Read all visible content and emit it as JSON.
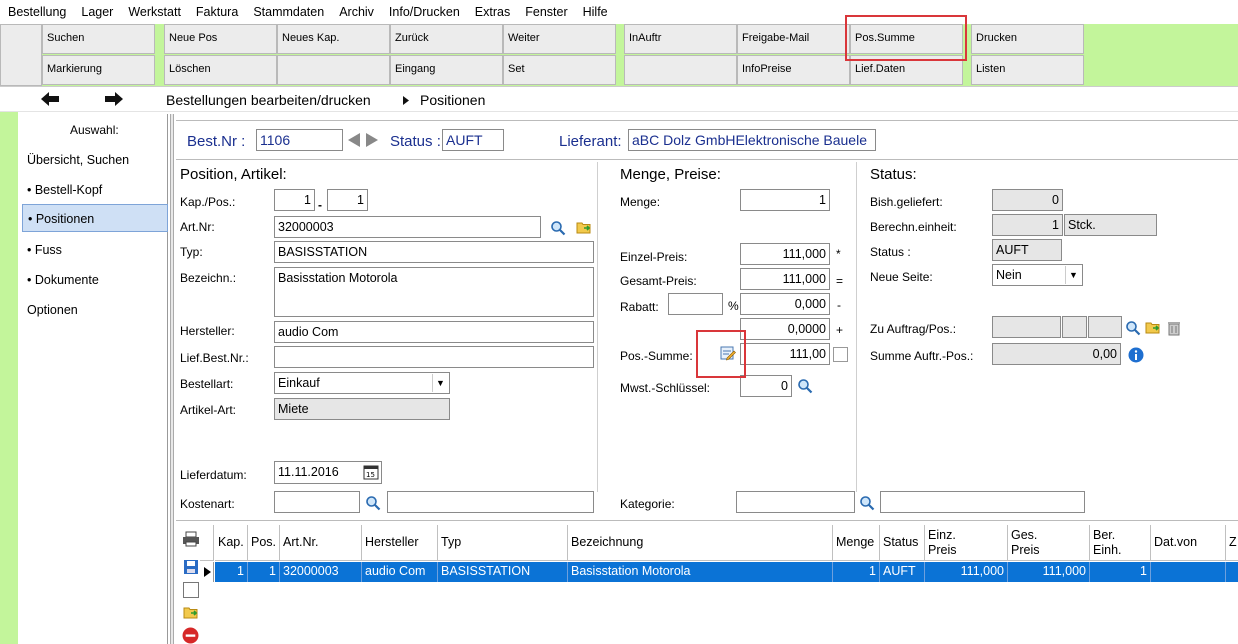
{
  "menu": [
    "Bestellung",
    "Lager",
    "Werkstatt",
    "Faktura",
    "Stammdaten",
    "Archiv",
    "Info/Drucken",
    "Extras",
    "Fenster",
    "Hilfe"
  ],
  "toolbar": {
    "suchen": "Suchen",
    "markierung": "Markierung",
    "neue_pos": "Neue Pos",
    "loeschen": "Löschen",
    "neues_kap": "Neues Kap.",
    "zurueck": "Zurück",
    "eingang": "Eingang",
    "weiter": "Weiter",
    "set": "Set",
    "inauftr": "InAuftr",
    "freigabe_mail": "Freigabe-Mail",
    "infopreise": "InfoPreise",
    "pos_summe": "Pos.Summe",
    "lief_daten": "Lief.Daten",
    "drucken": "Drucken",
    "listen": "Listen"
  },
  "breadcrumb": {
    "part1": "Bestellungen bearbeiten/drucken",
    "part2": "Positionen"
  },
  "sidebar": {
    "heading": "Auswahl:",
    "items": [
      "Übersicht, Suchen",
      "• Bestell-Kopf",
      "• Positionen",
      "• Fuss",
      "• Dokumente",
      "Optionen"
    ]
  },
  "header": {
    "best_nr_label": "Best.Nr :",
    "best_nr": "1106",
    "status_label": "Status :",
    "status": "AUFT",
    "lieferant_label": "Lieferant:",
    "lieferant": "aBC Dolz GmbHElektronische Bauele"
  },
  "position": {
    "title": "Position, Artikel:",
    "kap_label": "Kap./Pos.:",
    "kap": "1",
    "pos": "1",
    "sep": "-",
    "artnr_label": "Art.Nr:",
    "artnr": "32000003",
    "typ_label": "Typ:",
    "typ": "BASISSTATION",
    "bez_label": "Bezeichn.:",
    "bez": "Basisstation Motorola",
    "hersteller_label": "Hersteller:",
    "hersteller": "audio Com",
    "lief_label": "Lief.Best.Nr.:",
    "lief": "",
    "bestellart_label": "Bestellart:",
    "bestellart": "Einkauf",
    "artikelart_label": "Artikel-Art:",
    "artikelart": "Miete",
    "lieferdatum_label": "Lieferdatum:",
    "lieferdatum": "11.11.2016",
    "kostenart_label": "Kostenart:"
  },
  "preise": {
    "title": "Menge, Preise:",
    "menge_label": "Menge:",
    "menge": "1",
    "einzel_label": "Einzel-Preis:",
    "einzel": "111,000",
    "einzel_op": "*",
    "gesamt_label": "Gesamt-Preis:",
    "gesamt": "111,000",
    "gesamt_op": "=",
    "rabatt_label": "Rabatt:",
    "rabatt_pct": "",
    "pct_sign": "%",
    "rabatt": "0,000",
    "rabatt_op": "-",
    "extra": "0,0000",
    "extra_op": "+",
    "possumme_label": "Pos.-Summe:",
    "possumme": "111,00",
    "mwst_label": "Mwst.-Schlüssel:",
    "mwst": "0",
    "kategorie_label": "Kategorie:"
  },
  "status": {
    "title": "Status:",
    "geliefert_label": "Bish.geliefert:",
    "geliefert": "0",
    "berechn_label": "Berechn.einheit:",
    "berechn": "1",
    "einheit": "Stck.",
    "status_label": "Status :",
    "status": "AUFT",
    "seite_label": "Neue Seite:",
    "seite": "Nein",
    "auftrag_label": "Zu Auftrag/Pos.:",
    "summe_label": "Summe Auftr.-Pos.:",
    "summe": "0,00"
  },
  "grid": {
    "headers": [
      "Kap.",
      "Pos.",
      "Art.Nr.",
      "Hersteller",
      "Typ",
      "Bezeichnung",
      "Menge",
      "Status",
      "Einz.\nPreis",
      "Ges.\nPreis",
      "Ber.\nEinh.",
      "Dat.von",
      "Z"
    ],
    "row": [
      "1",
      "1",
      "32000003",
      "audio Com",
      "BASISSTATION",
      "Basisstation Motorola",
      "1",
      "AUFT",
      "111,000",
      "111,000",
      "1",
      "",
      ""
    ]
  }
}
